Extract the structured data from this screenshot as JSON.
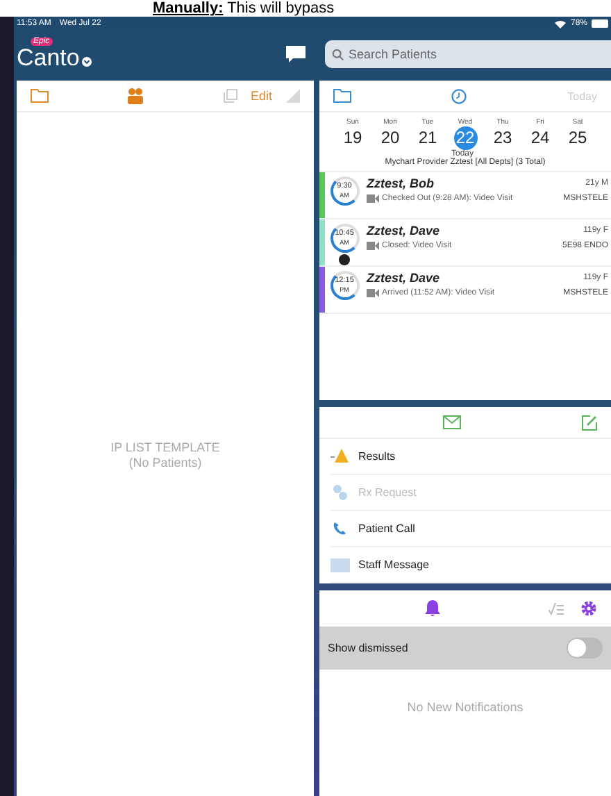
{
  "caption": {
    "lead": "Manually:",
    "text": "This will bypass"
  },
  "status_bar": {
    "time": "11:53 AM",
    "date": "Wed Jul 22",
    "battery": "78%"
  },
  "header": {
    "logo_badge": "Epic",
    "logo": "Canto",
    "search": {
      "placeholder": "Search Patients"
    }
  },
  "patient_list": {
    "edit": "Edit",
    "title": "IP LIST TEMPLATE",
    "empty": "(No Patients)"
  },
  "schedule": {
    "today_button": "Today",
    "days": [
      {
        "weekday": "Sun",
        "date": "19",
        "selected": false
      },
      {
        "weekday": "Mon",
        "date": "20",
        "selected": false
      },
      {
        "weekday": "Tue",
        "date": "21",
        "selected": false
      },
      {
        "weekday": "Wed",
        "date": "22",
        "selected": true
      },
      {
        "weekday": "Thu",
        "date": "23",
        "selected": false
      },
      {
        "weekday": "Fri",
        "date": "24",
        "selected": false
      },
      {
        "weekday": "Sat",
        "date": "25",
        "selected": false
      }
    ],
    "today_label": "Today",
    "provider": "Mychart Provider Zztest [All Depts] (3 Total)",
    "appointments": [
      {
        "time": "9:30",
        "meridiem": "AM",
        "name": "Zztest, Bob",
        "age_sex": "21y M",
        "status": "Checked Out (9:28 AM): Video Visit",
        "department": "MSHSTELE",
        "color": "#5cc55c",
        "flagged": false
      },
      {
        "time": "10:45",
        "meridiem": "AM",
        "name": "Zztest, Dave",
        "age_sex": "119y F",
        "status": "Closed: Video Visit",
        "department": "5E98 ENDO",
        "color": "#8fe0c4",
        "flagged": true
      },
      {
        "time": "12:15",
        "meridiem": "PM",
        "name": "Zztest, Dave",
        "age_sex": "119y F",
        "status": "Arrived (11:52 AM): Video Visit",
        "department": "MSHSTELE",
        "color": "#8a5ae0",
        "flagged": false
      }
    ]
  },
  "messages": {
    "items": [
      {
        "kind": "results",
        "label": "Results",
        "disabled": false
      },
      {
        "kind": "rx",
        "label": "Rx Request",
        "disabled": true
      },
      {
        "kind": "call",
        "label": "Patient Call",
        "disabled": false
      },
      {
        "kind": "staff",
        "label": "Staff Message",
        "disabled": false
      }
    ]
  },
  "notifications": {
    "show_dismissed": {
      "label": "Show dismissed",
      "on": false
    },
    "empty": "No New Notifications"
  }
}
